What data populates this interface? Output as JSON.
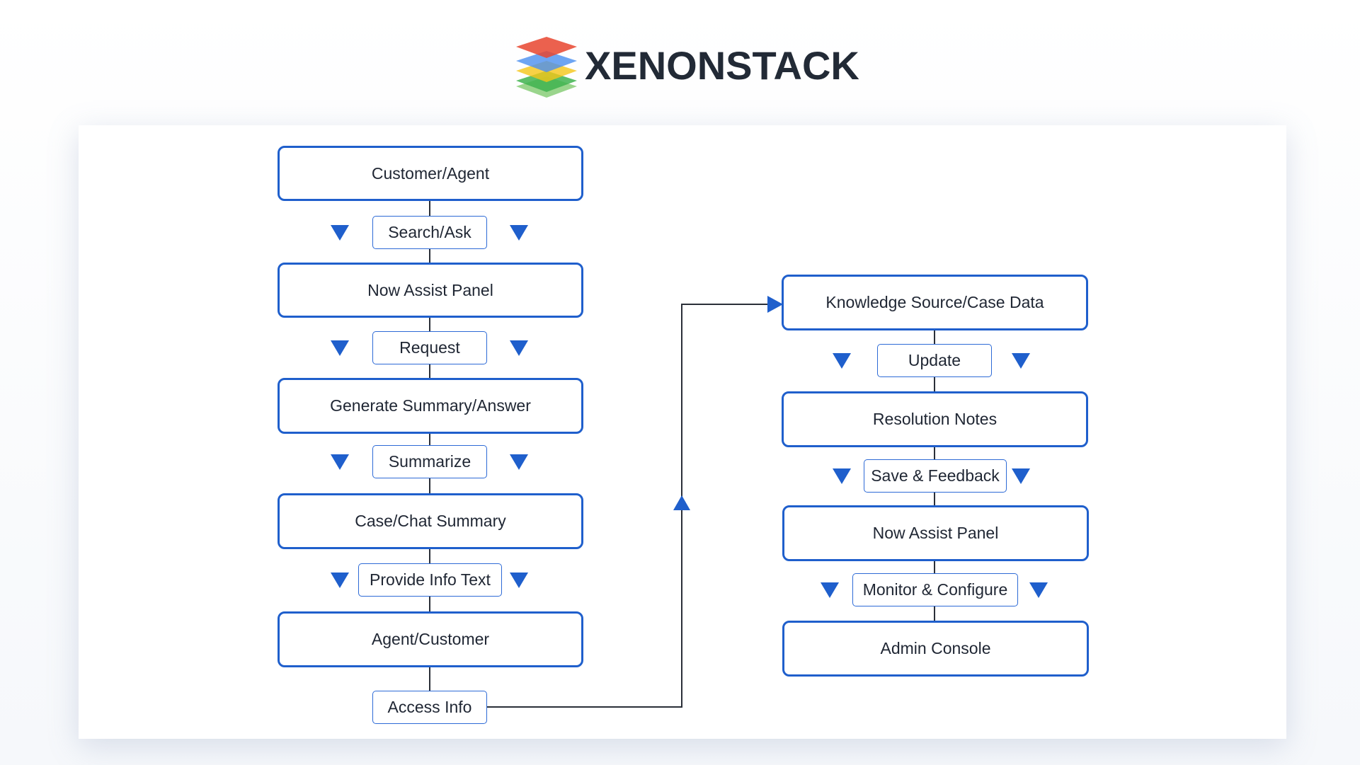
{
  "logo": {
    "text": "XENONSTACK",
    "colors": [
      "#e8452f",
      "#4a8ff0",
      "#f5c518",
      "#3fb34f"
    ]
  },
  "colors": {
    "accent": "#1f5fcc",
    "line": "#2a2f38"
  },
  "left_flow": {
    "nodes": [
      "Customer/Agent",
      "Now Assist Panel",
      "Generate Summary/Answer",
      "Case/Chat Summary",
      "Agent/Customer"
    ],
    "edges": [
      "Search/Ask",
      "Request",
      "Summarize",
      "Provide Info Text",
      "Access Info"
    ]
  },
  "right_flow": {
    "nodes": [
      "Knowledge Source/Case Data",
      "Resolution Notes",
      "Now Assist Panel",
      "Admin Console"
    ],
    "edges": [
      "Update",
      "Save & Feedback",
      "Monitor & Configure"
    ]
  }
}
